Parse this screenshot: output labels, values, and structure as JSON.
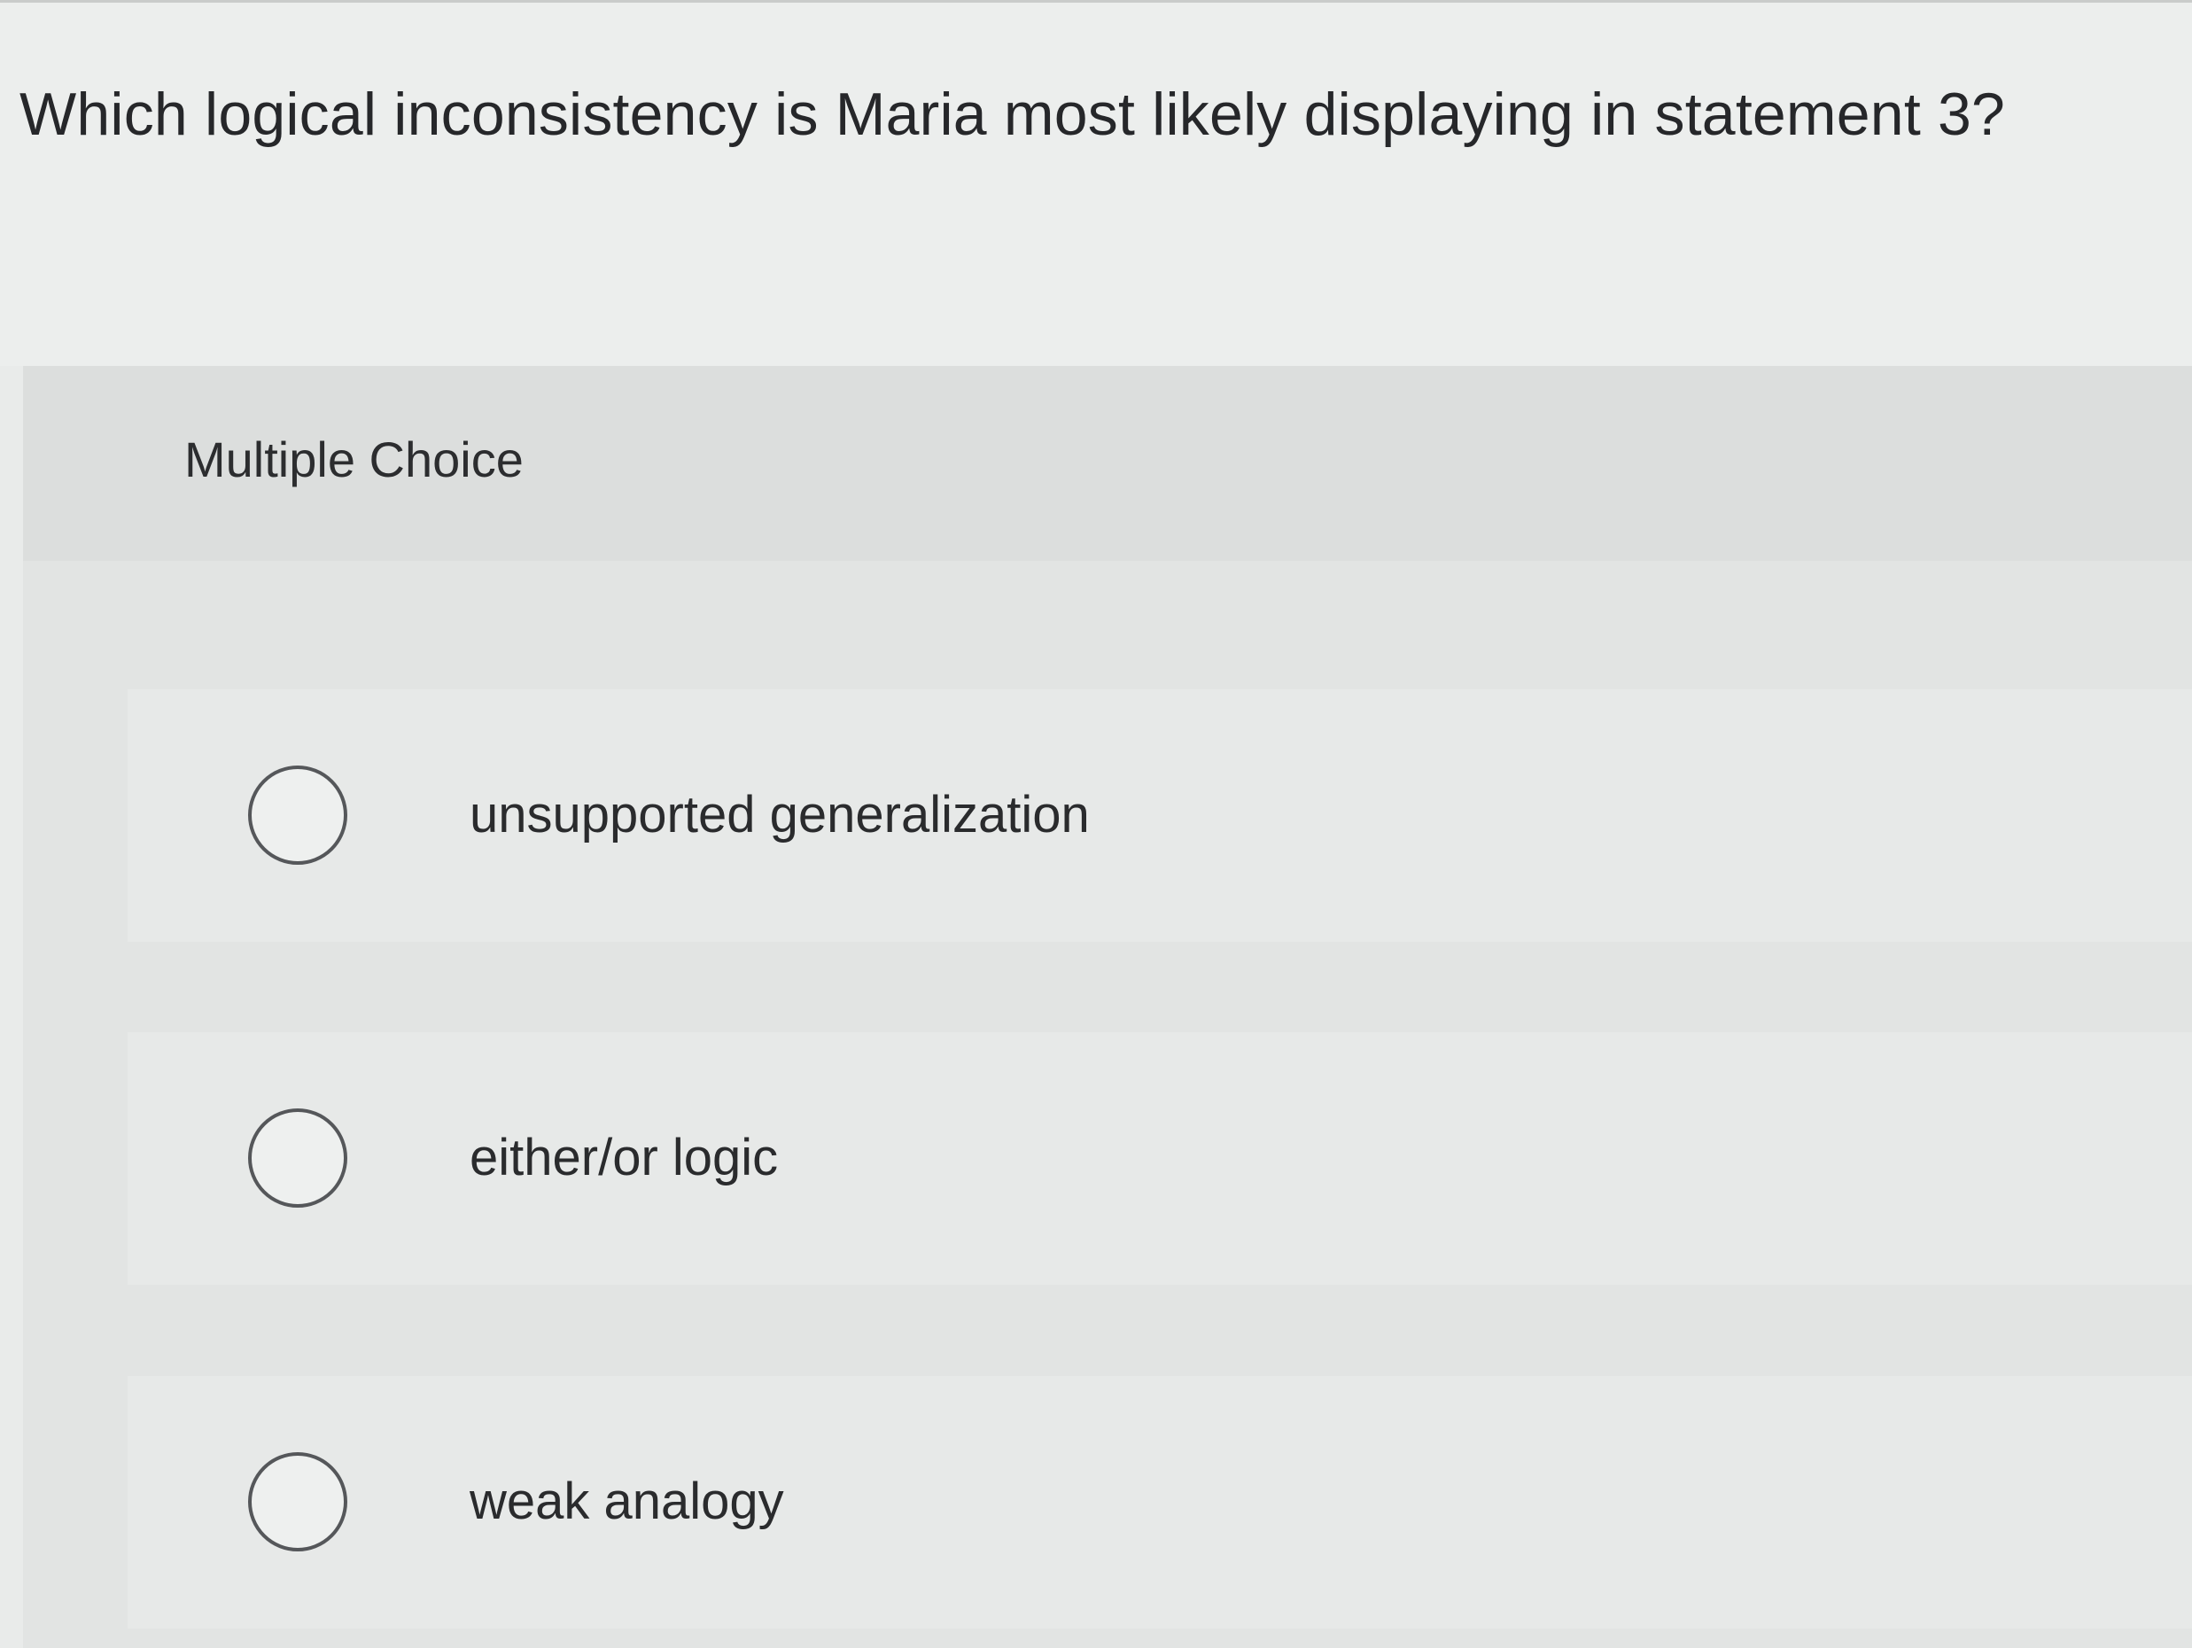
{
  "question": {
    "text": "Which logical inconsistency is Maria most likely displaying in statement 3?"
  },
  "multiple_choice": {
    "label": "Multiple Choice",
    "options": [
      {
        "label": "unsupported generalization",
        "selected": false
      },
      {
        "label": "either/or logic",
        "selected": false
      },
      {
        "label": "weak analogy",
        "selected": false
      }
    ]
  }
}
